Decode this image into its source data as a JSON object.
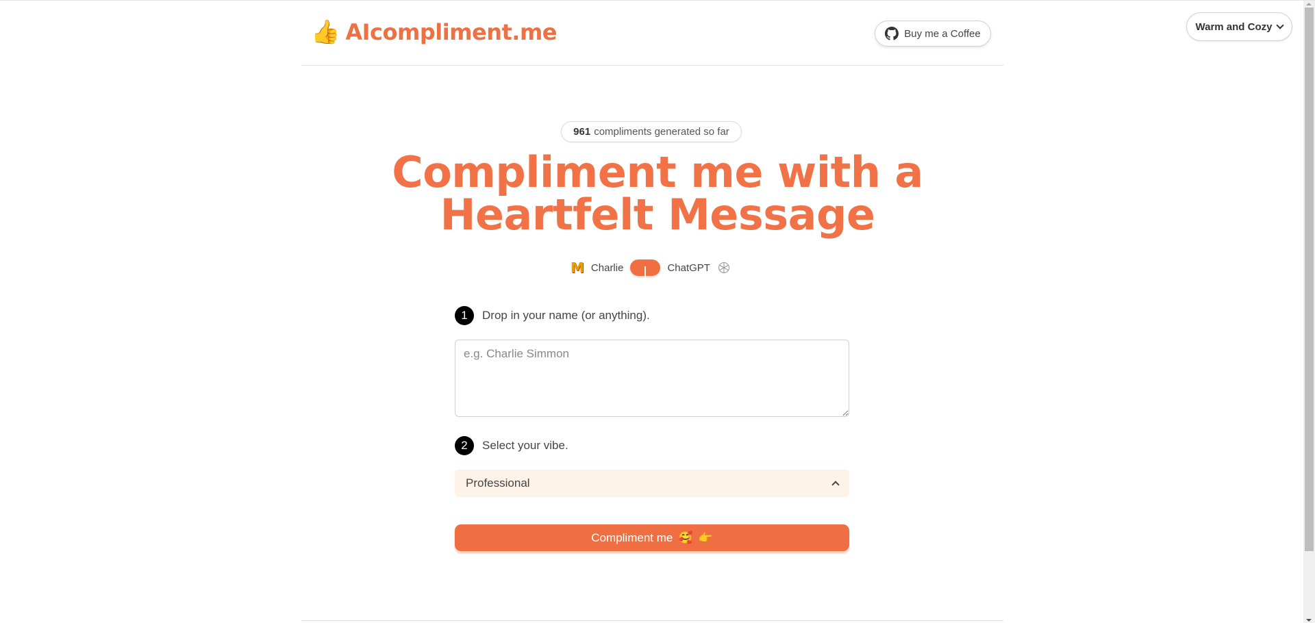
{
  "header": {
    "logo_emoji": "👍",
    "logo_text": "AIcompliment.me",
    "coffee_button": {
      "label": "Buy me a Coffee",
      "icon": "github-icon"
    }
  },
  "theme_selector": {
    "selected": "Warm and Cozy",
    "icon": "chevron-down-icon"
  },
  "stats_badge": {
    "count": "961",
    "suffix": "compliments generated so far"
  },
  "hero": {
    "line1": "Compliment me with a",
    "line2": "Heartfelt Message"
  },
  "model_toggle": {
    "left_icon": "M",
    "left_label": "Charlie",
    "right_label": "ChatGPT",
    "right_icon": "openai-icon"
  },
  "steps": [
    {
      "number": "1",
      "label": "Drop in your name (or anything)."
    },
    {
      "number": "2",
      "label": "Select your vibe."
    }
  ],
  "name_input": {
    "placeholder": "e.g. Charlie Simmon",
    "value": ""
  },
  "vibe_select": {
    "selected": "Professional",
    "icon": "chevron-up-icon"
  },
  "submit_button": {
    "label": "Compliment me",
    "emoji1": "🥰",
    "emoji2": "👉"
  },
  "colors": {
    "accent": "#ef6f43",
    "select_bg": "#fdf3e8"
  }
}
